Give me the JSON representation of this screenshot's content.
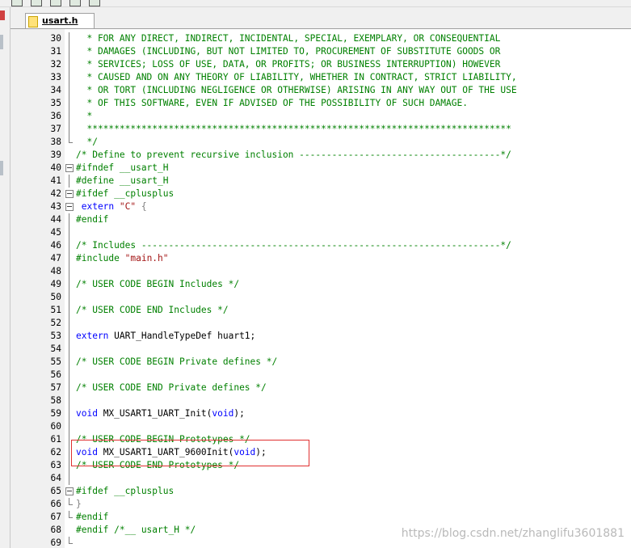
{
  "tab": {
    "label": "usart.h"
  },
  "watermark": "https://blog.csdn.net/zhanglifu3601881",
  "colors": {
    "comment": "#008000",
    "keyword": "#0000ff",
    "string": "#a31515",
    "highlight": "#e03030"
  },
  "lines": [
    {
      "n": "30",
      "fold": "bar",
      "parts": [
        {
          "t": "  * FOR ANY DIRECT, INDIRECT, INCIDENTAL, SPECIAL, EXEMPLARY, OR CONSEQUENTIAL",
          "c": "comment"
        }
      ]
    },
    {
      "n": "31",
      "fold": "bar",
      "parts": [
        {
          "t": "  * DAMAGES (INCLUDING, BUT NOT LIMITED TO, PROCUREMENT OF SUBSTITUTE GOODS OR",
          "c": "comment"
        }
      ]
    },
    {
      "n": "32",
      "fold": "bar",
      "parts": [
        {
          "t": "  * SERVICES; LOSS OF USE, DATA, OR PROFITS; OR BUSINESS INTERRUPTION) HOWEVER",
          "c": "comment"
        }
      ]
    },
    {
      "n": "33",
      "fold": "bar",
      "parts": [
        {
          "t": "  * CAUSED AND ON ANY THEORY OF LIABILITY, WHETHER IN CONTRACT, STRICT LIABILITY,",
          "c": "comment"
        }
      ]
    },
    {
      "n": "34",
      "fold": "bar",
      "parts": [
        {
          "t": "  * OR TORT (INCLUDING NEGLIGENCE OR OTHERWISE) ARISING IN ANY WAY OUT OF THE USE",
          "c": "comment"
        }
      ]
    },
    {
      "n": "35",
      "fold": "bar",
      "parts": [
        {
          "t": "  * OF THIS SOFTWARE, EVEN IF ADVISED OF THE POSSIBILITY OF SUCH DAMAGE.",
          "c": "comment"
        }
      ]
    },
    {
      "n": "36",
      "fold": "bar",
      "parts": [
        {
          "t": "  *",
          "c": "comment"
        }
      ]
    },
    {
      "n": "37",
      "fold": "bar",
      "parts": [
        {
          "t": "  ******************************************************************************",
          "c": "comment"
        }
      ]
    },
    {
      "n": "38",
      "fold": "end",
      "parts": [
        {
          "t": "  */",
          "c": "comment"
        }
      ]
    },
    {
      "n": "39",
      "fold": "",
      "parts": [
        {
          "t": "/* Define to prevent recursive inclusion -------------------------------------*/",
          "c": "comment"
        }
      ]
    },
    {
      "n": "40",
      "fold": "box",
      "parts": [
        {
          "t": "#ifndef __usart_H",
          "c": "pp"
        }
      ]
    },
    {
      "n": "41",
      "fold": "bar",
      "parts": [
        {
          "t": "#define __usart_H",
          "c": "pp"
        }
      ]
    },
    {
      "n": "42",
      "fold": "box",
      "parts": [
        {
          "t": "#ifdef __cplusplus",
          "c": "pp"
        }
      ]
    },
    {
      "n": "43",
      "fold": "box",
      "parts": [
        {
          "t": " extern ",
          "c": "kw"
        },
        {
          "t": "\"C\"",
          "c": "str"
        },
        {
          "t": " {",
          "c": "brace"
        }
      ]
    },
    {
      "n": "44",
      "fold": "bar",
      "parts": [
        {
          "t": "#endif",
          "c": "pp"
        }
      ]
    },
    {
      "n": "45",
      "fold": "bar",
      "parts": [
        {
          "t": "",
          "c": "plain"
        }
      ]
    },
    {
      "n": "46",
      "fold": "bar",
      "parts": [
        {
          "t": "/* Includes ------------------------------------------------------------------*/",
          "c": "comment"
        }
      ]
    },
    {
      "n": "47",
      "fold": "bar",
      "parts": [
        {
          "t": "#include ",
          "c": "pp"
        },
        {
          "t": "\"main.h\"",
          "c": "str"
        }
      ]
    },
    {
      "n": "48",
      "fold": "bar",
      "parts": [
        {
          "t": "",
          "c": "plain"
        }
      ]
    },
    {
      "n": "49",
      "fold": "bar",
      "parts": [
        {
          "t": "/* USER CODE BEGIN Includes */",
          "c": "comment"
        }
      ]
    },
    {
      "n": "50",
      "fold": "bar",
      "parts": [
        {
          "t": "",
          "c": "plain"
        }
      ]
    },
    {
      "n": "51",
      "fold": "bar",
      "parts": [
        {
          "t": "/* USER CODE END Includes */",
          "c": "comment"
        }
      ]
    },
    {
      "n": "52",
      "fold": "bar",
      "parts": [
        {
          "t": "",
          "c": "plain"
        }
      ]
    },
    {
      "n": "53",
      "fold": "bar",
      "parts": [
        {
          "t": "extern ",
          "c": "kw"
        },
        {
          "t": "UART_HandleTypeDef huart1;",
          "c": "plain"
        }
      ]
    },
    {
      "n": "54",
      "fold": "bar",
      "parts": [
        {
          "t": "",
          "c": "plain"
        }
      ]
    },
    {
      "n": "55",
      "fold": "bar",
      "parts": [
        {
          "t": "/* USER CODE BEGIN Private defines */",
          "c": "comment"
        }
      ]
    },
    {
      "n": "56",
      "fold": "bar",
      "parts": [
        {
          "t": "",
          "c": "plain"
        }
      ]
    },
    {
      "n": "57",
      "fold": "bar",
      "parts": [
        {
          "t": "/* USER CODE END Private defines */",
          "c": "comment"
        }
      ]
    },
    {
      "n": "58",
      "fold": "bar",
      "parts": [
        {
          "t": "",
          "c": "plain"
        }
      ]
    },
    {
      "n": "59",
      "fold": "bar",
      "parts": [
        {
          "t": "void ",
          "c": "kw"
        },
        {
          "t": "MX_USART1_UART_Init(",
          "c": "plain"
        },
        {
          "t": "void",
          "c": "kw"
        },
        {
          "t": ");",
          "c": "plain"
        }
      ]
    },
    {
      "n": "60",
      "fold": "bar",
      "parts": [
        {
          "t": "",
          "c": "plain"
        }
      ]
    },
    {
      "n": "61",
      "fold": "bar",
      "parts": [
        {
          "t": "/* USER CODE BEGIN Prototypes */",
          "c": "comment"
        }
      ]
    },
    {
      "n": "62",
      "fold": "bar",
      "parts": [
        {
          "t": "void ",
          "c": "kw"
        },
        {
          "t": "MX_USART1_UART_9600Init(",
          "c": "plain"
        },
        {
          "t": "void",
          "c": "kw"
        },
        {
          "t": ");",
          "c": "plain"
        }
      ]
    },
    {
      "n": "63",
      "fold": "bar",
      "parts": [
        {
          "t": "/* USER CODE END Prototypes */",
          "c": "comment"
        }
      ]
    },
    {
      "n": "64",
      "fold": "bar",
      "parts": [
        {
          "t": "",
          "c": "plain"
        }
      ]
    },
    {
      "n": "65",
      "fold": "box",
      "parts": [
        {
          "t": "#ifdef __cplusplus",
          "c": "pp"
        }
      ]
    },
    {
      "n": "66",
      "fold": "end",
      "parts": [
        {
          "t": "}",
          "c": "brace"
        }
      ]
    },
    {
      "n": "67",
      "fold": "end",
      "parts": [
        {
          "t": "#endif",
          "c": "pp"
        }
      ]
    },
    {
      "n": "68",
      "fold": "",
      "parts": [
        {
          "t": "#endif /*__ usart_H */",
          "c": "pp"
        }
      ]
    },
    {
      "n": "69",
      "fold": "end",
      "parts": [
        {
          "t": "",
          "c": "plain"
        }
      ]
    }
  ]
}
